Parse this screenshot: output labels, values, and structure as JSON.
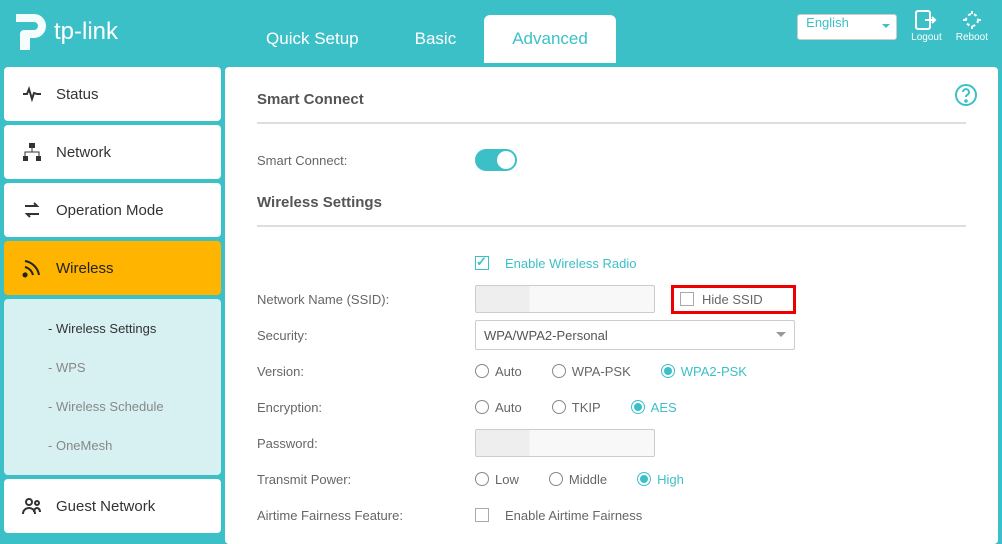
{
  "header": {
    "brand": "tp-link",
    "tabs": {
      "quick": "Quick Setup",
      "basic": "Basic",
      "advanced": "Advanced"
    },
    "lang": "English",
    "logout": "Logout",
    "reboot": "Reboot"
  },
  "sidebar": {
    "status": "Status",
    "network": "Network",
    "operation": "Operation Mode",
    "wireless": "Wireless",
    "sub": {
      "settings": "Wireless Settings",
      "wps": "WPS",
      "schedule": "Wireless Schedule",
      "onemesh": "OneMesh"
    },
    "guest": "Guest Network"
  },
  "content": {
    "smart_title": "Smart Connect",
    "smart_label": "Smart Connect:",
    "ws_title": "Wireless Settings",
    "enable_radio": "Enable Wireless Radio",
    "ssid_label": "Network Name (SSID):",
    "hide_ssid": "Hide SSID",
    "security_label": "Security:",
    "security_value": "WPA/WPA2-Personal",
    "version_label": "Version:",
    "version_opts": {
      "auto": "Auto",
      "wpa": "WPA-PSK",
      "wpa2": "WPA2-PSK"
    },
    "encryption_label": "Encryption:",
    "encryption_opts": {
      "auto": "Auto",
      "tkip": "TKIP",
      "aes": "AES"
    },
    "password_label": "Password:",
    "tx_label": "Transmit Power:",
    "tx_opts": {
      "low": "Low",
      "mid": "Middle",
      "high": "High"
    },
    "airtime_label": "Airtime Fairness Feature:",
    "airtime_chk": "Enable Airtime Fairness"
  }
}
